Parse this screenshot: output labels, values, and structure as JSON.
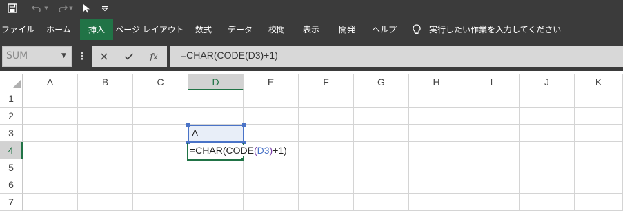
{
  "quick_access": {
    "items": [
      "save-icon",
      "undo-icon",
      "redo-icon",
      "cursor-icon",
      "customize-icon"
    ]
  },
  "ribbon": {
    "tabs": [
      {
        "label": "ファイル",
        "active": false
      },
      {
        "label": "ホーム",
        "active": false
      },
      {
        "label": "挿入",
        "active": true
      },
      {
        "label": "ページ レイアウト",
        "active": false
      },
      {
        "label": "数式",
        "active": false
      },
      {
        "label": "データ",
        "active": false
      },
      {
        "label": "校閲",
        "active": false
      },
      {
        "label": "表示",
        "active": false
      },
      {
        "label": "開発",
        "active": false
      },
      {
        "label": "ヘルプ",
        "active": false
      }
    ],
    "tell_me": "実行したい作業を入力してください"
  },
  "formula_bar": {
    "name_box": "SUM",
    "cancel_icon": "close-icon",
    "enter_icon": "check-icon",
    "function_label": "fx",
    "formula": "=CHAR(CODE(D3)+1)"
  },
  "sheet": {
    "columns": [
      "A",
      "B",
      "C",
      "D",
      "E",
      "F",
      "G",
      "H",
      "I",
      "J",
      "K"
    ],
    "rows": [
      "1",
      "2",
      "3",
      "4",
      "5",
      "6",
      "7"
    ],
    "active_column": "D",
    "active_row": "4",
    "cell_D3": "A",
    "cell_D4_edit": {
      "prefix": "=CHAR(CODE",
      "open_paren": "(",
      "ref": "D3",
      "close_paren": ")",
      "suffix": "+1)"
    }
  },
  "colors": {
    "chrome": "#3b3b3b",
    "accent": "#217346",
    "reference": "#4a73c7"
  }
}
